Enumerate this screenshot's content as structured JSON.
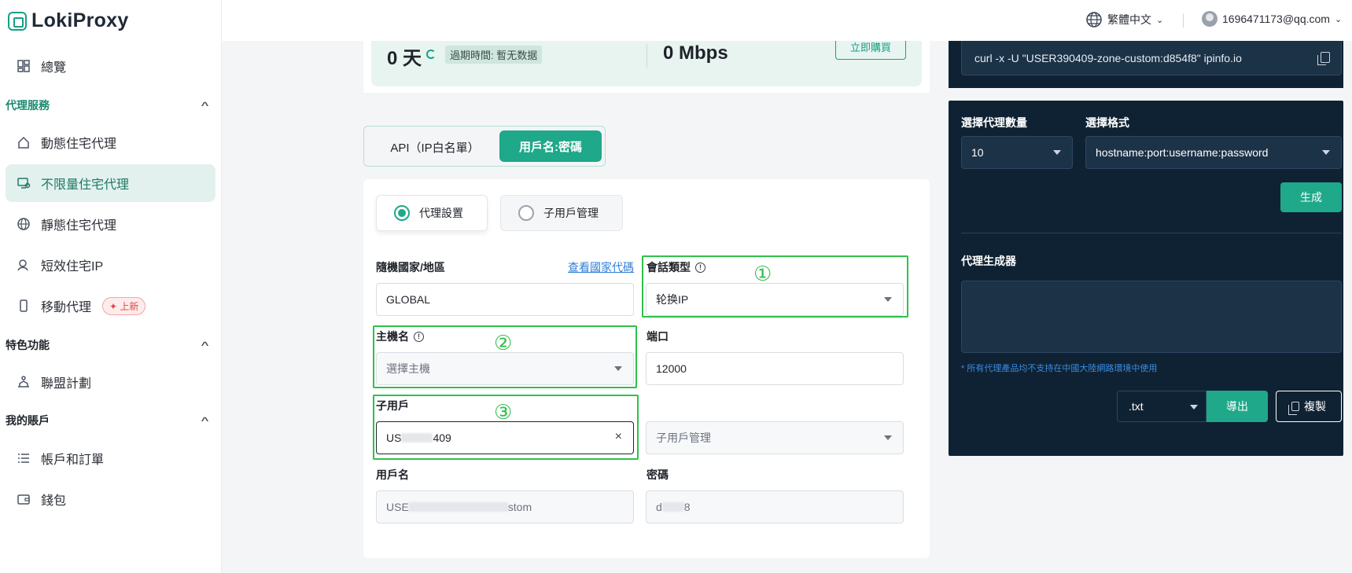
{
  "brand": {
    "name": "LokiProxy"
  },
  "sidebar": {
    "overview": "總覽",
    "section_proxy": "代理服務",
    "items": [
      {
        "label": "動態住宅代理"
      },
      {
        "label": "不限量住宅代理"
      },
      {
        "label": "靜態住宅代理"
      },
      {
        "label": "短效住宅IP"
      },
      {
        "label": "移動代理",
        "badge": "✦ 上新"
      }
    ],
    "section_features": "特色功能",
    "affiliate": "聯盟計劃",
    "section_account": "我的賬戶",
    "orders": "帳戶和訂單",
    "wallet": "錢包"
  },
  "header": {
    "language": "繁體中文",
    "user": "1696471173@qq.com"
  },
  "summary": {
    "days": "0 天",
    "expire_label": "過期時間: 暫无数据",
    "bandwidth": "0 Mbps",
    "buy_button": "立即購買"
  },
  "mode_toggle": {
    "api": "API（IP白名單）",
    "userpass": "用戶名:密碼"
  },
  "sub_tabs": {
    "settings": "代理設置",
    "subusers": "子用戶管理"
  },
  "form": {
    "country_label": "隨機國家/地區",
    "country_link": "查看國家代碼",
    "country_value": "GLOBAL",
    "session_label": "會話類型",
    "session_value": "轮换IP",
    "host_label": "主機名",
    "host_placeholder": "選擇主機",
    "port_label": "端口",
    "port_value": "12000",
    "subuser_label": "子用戶",
    "subuser_value_prefix": "US",
    "subuser_value_suffix": "409",
    "subuser_select": "子用戶管理",
    "username_label": "用戶名",
    "username_prefix": "USE",
    "username_suffix": "stom",
    "password_label": "密碼",
    "password_prefix": "d",
    "password_suffix": "8"
  },
  "annotations": [
    "①",
    "②",
    "③"
  ],
  "right_panel": {
    "curl": "curl -x -U \"USER390409-zone-custom:d854f8\" ipinfo.io",
    "count_label": "選擇代理數量",
    "count_value": "10",
    "format_label": "選擇格式",
    "format_value": "hostname:port:username:password",
    "generate_button": "生成",
    "generator_label": "代理生成器",
    "notice": "* 所有代理產品均不支持在中國大陸網路環境中使用",
    "file_format": ".txt",
    "export_button": "導出",
    "copy_button": "複製"
  },
  "colors": {
    "accent": "#1fa88a",
    "dark_panel": "#0f2233",
    "annotation": "#2ec14a"
  }
}
